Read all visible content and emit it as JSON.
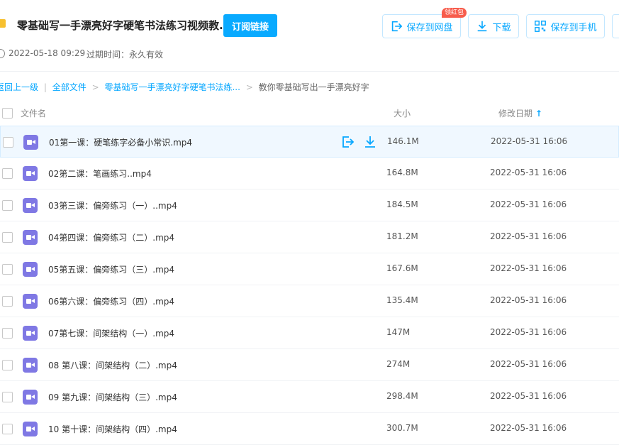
{
  "header": {
    "title": "零基础写一手漂亮好字硬笔书法练习视频教...",
    "subscribe_label": "订阅链接",
    "save_to_disk_label": "保存到网盘",
    "red_packet_badge": "领红包",
    "download_label": "下载",
    "save_to_phone_label": "保存到手机"
  },
  "meta": {
    "created": "2022-05-18 09:29",
    "expiry": "过期时间：永久有效"
  },
  "breadcrumb": {
    "back": "返回上一级",
    "all_files": "全部文件",
    "folder": "零基础写一手漂亮好字硬笔书法练...",
    "current": "教你零基础写出一手漂亮好字",
    "separator": "|",
    "arrow": ">"
  },
  "table": {
    "col_name": "文件名",
    "col_size": "大小",
    "col_date": "修改日期",
    "sort_arrow": "↑",
    "rows": [
      {
        "name": "01第一课：硬笔练字必备小常识.mp4",
        "size": "146.1M",
        "date": "2022-05-31 16:06"
      },
      {
        "name": "02第二课：笔画练习..mp4",
        "size": "164.8M",
        "date": "2022-05-31 16:06"
      },
      {
        "name": "03第三课：偏旁练习（一）..mp4",
        "size": "184.5M",
        "date": "2022-05-31 16:06"
      },
      {
        "name": "04第四课：偏旁练习（二）.mp4",
        "size": "181.2M",
        "date": "2022-05-31 16:06"
      },
      {
        "name": "05第五课：偏旁练习（三）.mp4",
        "size": "167.6M",
        "date": "2022-05-31 16:06"
      },
      {
        "name": "06第六课：偏旁练习（四）.mp4",
        "size": "135.4M",
        "date": "2022-05-31 16:06"
      },
      {
        "name": "07第七课：间架结构（一）.mp4",
        "size": "147M",
        "date": "2022-05-31 16:06"
      },
      {
        "name": "08 第八课：间架结构（二）.mp4",
        "size": "274M",
        "date": "2022-05-31 16:06"
      },
      {
        "name": "09 第九课：间架结构（三）.mp4",
        "size": "298.4M",
        "date": "2022-05-31 16:06"
      },
      {
        "name": "10 第十课：间架结构（四）.mp4",
        "size": "300.7M",
        "date": "2022-05-31 16:06"
      }
    ]
  },
  "colors": {
    "accent": "#06a7ff",
    "video_icon": "#7f78e4",
    "badge": "#f75c4c"
  },
  "icons": [
    "folder-icon",
    "save-to-disk-icon",
    "download-icon",
    "qr-code-icon",
    "clock-icon",
    "video-file-icon",
    "sort-up-icon"
  ]
}
